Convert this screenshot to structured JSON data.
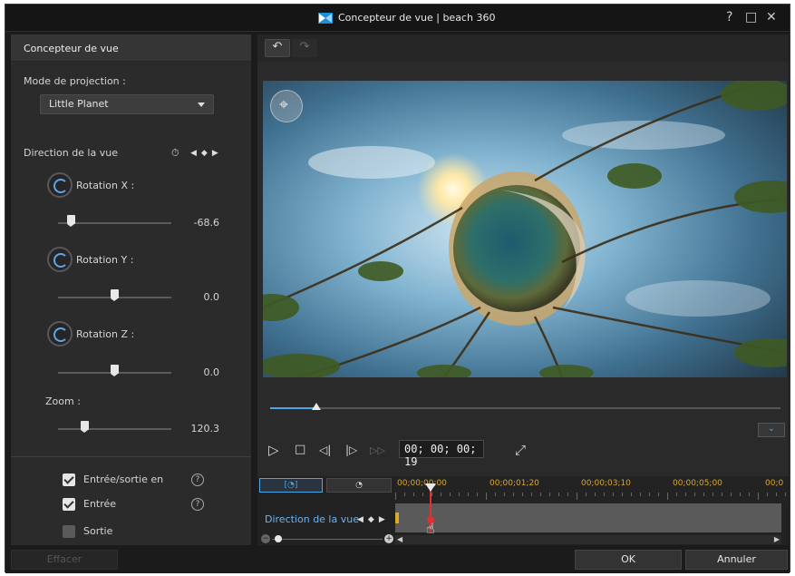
{
  "window": {
    "title": "Concepteur de vue  |  beach 360",
    "help_icon": "?",
    "maximize_icon": "□",
    "close_icon": "✕"
  },
  "left_panel": {
    "header": "Concepteur de vue",
    "projection_label": "Mode de projection :",
    "projection_value": "Little Planet",
    "direction_label": "Direction de la vue",
    "rotation_x": {
      "label": "Rotation X :",
      "value": "-68.6",
      "position": 0.12
    },
    "rotation_y": {
      "label": "Rotation Y :",
      "value": "0.0",
      "position": 0.5
    },
    "rotation_z": {
      "label": "Rotation Z :",
      "value": "0.0",
      "position": 0.5
    },
    "zoom": {
      "label": "Zoom :",
      "value": "120.3",
      "position": 0.25
    },
    "checkboxes": [
      {
        "label": "Entrée/sortie en",
        "checked": true,
        "help": "?"
      },
      {
        "label": "Entrée",
        "checked": true,
        "help": "?"
      },
      {
        "label": "Sortie",
        "checked": false
      }
    ]
  },
  "toolbar": {
    "undo_icon": "↶",
    "redo_icon": "↷"
  },
  "player": {
    "progress": 0.09,
    "timecode": "00; 00; 00; 19",
    "play_icon": "▷",
    "stop_icon": "□",
    "prev_frame_icon": "◁|",
    "next_frame_icon": "|▷",
    "fast_forward_icon": "▷▷",
    "fullscreen_icon": "⤢",
    "expand_icon": "⌄"
  },
  "timeline": {
    "tab_direction_icon": "[◔]",
    "tab_clock_icon": "◔",
    "ticks": [
      "00;00;00;00",
      "00;00;01;20",
      "00;00;03;10",
      "00;00;05;00",
      "00;0"
    ],
    "track_name": "Direction de la vue",
    "zoom_out_icon": "−",
    "zoom_in_icon": "+",
    "scroll_left": "◀",
    "scroll_right": "▶"
  },
  "buttons": {
    "clear": "Effacer",
    "ok": "OK",
    "cancel": "Annuler"
  },
  "colors": {
    "accent": "#4aa7e6",
    "playhead": "#e23030",
    "timecode_tick": "#d9a82d"
  }
}
